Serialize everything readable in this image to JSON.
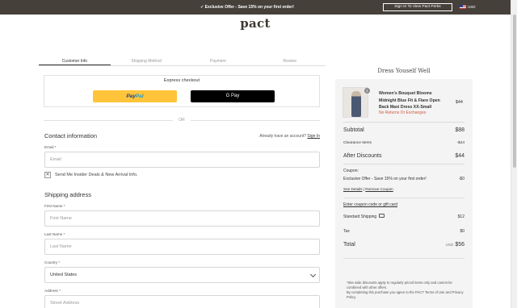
{
  "promo": {
    "text": "✓ Exclusive Offer - Save 15% on your first order!",
    "perks_button": "Sign In To View Pact Perks",
    "currency": "USD"
  },
  "logo": "pact",
  "steps": [
    "Customer Info",
    "Shipping Method",
    "Payment",
    "Review"
  ],
  "express": {
    "title": "Express checkout",
    "paypal_a": "Pay",
    "paypal_b": "Pal",
    "gpay": "G Pay",
    "or": "OR"
  },
  "contact": {
    "title": "Contact information",
    "have_account": "Already have an account?",
    "sign_in": "Sign In",
    "email_label": "Email *",
    "email_placeholder": "Email",
    "newsletter_label": "Send Me Insider Deals & New Arrival Info.",
    "newsletter_mark": "✕"
  },
  "shipping": {
    "title": "Shipping address",
    "first_name_label": "First Name *",
    "first_name_placeholder": "First Name",
    "last_name_label": "Last Name *",
    "last_name_placeholder": "Last Name",
    "country_label": "Country *",
    "country_value": "United States",
    "address_label": "Address *",
    "address_placeholder": "Street Address"
  },
  "summary": {
    "title": "Dress Youself Well",
    "item": {
      "quantity": "1",
      "name": "Women's Bouquet Blooms Midnight Blue Fit & Flare Open Back Maxi Dress XX-Small",
      "price": "$44",
      "note": "No Returns Or Exchanges"
    },
    "subtotal_label": "Subtotal",
    "subtotal": "$88",
    "clearance_label": "Clearance Items",
    "clearance": "-$44",
    "after_discounts_label": "After Discounts",
    "after_discounts": "$44",
    "coupon_title": "Coupon:",
    "coupon_text": "Exclusive Offer - Save 15% on your first order!",
    "coupon_amount": "-$0",
    "see_details": "See Details",
    "separator": "|",
    "remove_coupon": "Remove Coupon",
    "enter_coupon": "Enter coupon code or gift card",
    "shipping_label": "Standard Shipping",
    "shipping": "$12",
    "tax_label": "Tax",
    "tax": "$0",
    "total_label": "Total",
    "total_currency": "USD",
    "total": "$56",
    "fine_print_1": "*Site wide discounts apply to regularly priced items only and cannot be combined with other offers.",
    "fine_print_2": "By completing this purchase you agree to the PACT Terms of Use and Privacy Policy."
  },
  "colors": {
    "promo_bar": "#45403a",
    "paypal": "#ffc439",
    "warning": "#d0563b",
    "summary_bg": "#f4f4f4"
  }
}
